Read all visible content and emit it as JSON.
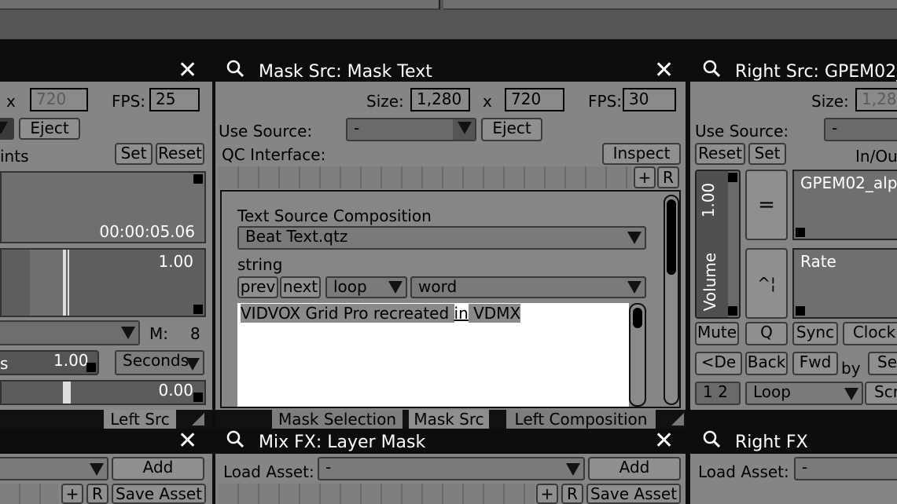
{
  "top_left_panel": {
    "close_symbol": "✕",
    "size_x_label": "x",
    "size_height": "720",
    "fps_label": "FPS:",
    "fps_value": "25",
    "eject_label": "Eject",
    "points_label": "ints",
    "set_label": "Set",
    "reset_label": "Reset",
    "timecode": "00:00:05.06",
    "rate_value": "1.00",
    "m_label": "M:",
    "m_value": "8",
    "s_label": "s",
    "s_value": "1.00",
    "seconds_label": "Seconds",
    "pos_value": "0.00",
    "tab_label": "Left Src"
  },
  "mask_src_panel": {
    "title": "Mask Src: Mask Text",
    "close_symbol": "✕",
    "size_label": "Size:",
    "width": "1,280",
    "x_label": "x",
    "height": "720",
    "fps_label": "FPS:",
    "fps_value": "30",
    "use_source_label": "Use Source:",
    "use_source_value": "-",
    "eject_label": "Eject",
    "qc_interface_label": "QC Interface:",
    "inspect_label": "Inspect",
    "plus_label": "+",
    "r_label": "R",
    "composition_label": "Text Source Composition",
    "composition_value": "Beat Text.qtz",
    "string_label": "string",
    "prev_label": "prev",
    "next_label": "next",
    "loop_label": "loop",
    "word_label": "word",
    "text_before": "VIDVOX Grid Pro recreated ",
    "text_highlight": "in",
    "text_after": " VDMX",
    "tabs": [
      "Mask Selection",
      "Mask Src",
      "Left Composition"
    ]
  },
  "right_src_panel": {
    "title": "Right Src: GPEM02_",
    "size_label": "Size:",
    "width": "1,28",
    "use_source_label": "Use Source:",
    "use_source_value": "-",
    "reset_label": "Reset",
    "set_label": "Set",
    "inout_label": "In/Ou",
    "volume_label": "Volume",
    "volume_value": "1.00",
    "equals_label": "=",
    "arrow_label": "^¦",
    "clip_name": "GPEM02_alp",
    "rate_label": "Rate",
    "mute_label": "Mute",
    "q_label": "Q",
    "sync_label": "Sync",
    "clock_label": "Clock",
    "del_label": "<De",
    "back_label": "Back",
    "fwd_label": "Fwd",
    "by_label": "by",
    "se_label": "Se",
    "half_label": "1 2",
    "loop_label": "Loop",
    "scr_label": "Scr"
  },
  "bottom_left_panel": {
    "close_symbol": "✕",
    "add_label": "Add",
    "plus_label": "+",
    "r_label": "R",
    "save_asset_label": "Save Asset"
  },
  "mix_fx_panel": {
    "title": "Mix FX: Layer Mask",
    "close_symbol": "✕",
    "load_asset_label": "Load Asset:",
    "load_asset_value": "-",
    "add_label": "Add",
    "plus_label": "+",
    "r_label": "R",
    "save_asset_label": "Save Asset"
  },
  "right_fx_panel": {
    "title": "Right FX",
    "load_asset_label": "Load Asset:",
    "load_asset_value": "-"
  },
  "colors": {
    "background": "#0d0d0d",
    "panel": "#858585",
    "header_text": "#ffffff"
  }
}
